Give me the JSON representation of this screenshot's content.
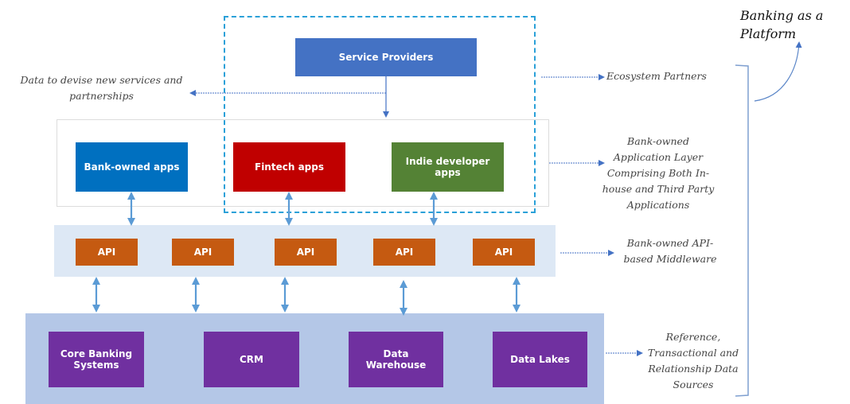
{
  "title": "Banking as a Platform",
  "colors": {
    "service_provider": "#4472c4",
    "bank_owned_app": "#0070c0",
    "fintech_app": "#c00000",
    "indie_app": "#548235",
    "api": "#c55a11",
    "data_source": "#7030a0",
    "middleware_band": "#dde8f5",
    "data_band": "#b4c7e7",
    "connector": "#5b9bd5",
    "ecosystem_border": "#2aa0d8"
  },
  "ecosystem": {
    "service_providers": "Service Providers"
  },
  "application_layer": {
    "apps": [
      {
        "label": "Bank-owned apps"
      },
      {
        "label": "Fintech apps"
      },
      {
        "label": "Indie developer apps"
      }
    ]
  },
  "middleware_layer": {
    "apis": [
      {
        "label": "API"
      },
      {
        "label": "API"
      },
      {
        "label": "API"
      },
      {
        "label": "API"
      },
      {
        "label": "API"
      }
    ]
  },
  "data_layer": {
    "sources": [
      {
        "label": "Core Banking Systems"
      },
      {
        "label": "CRM"
      },
      {
        "label": "Data Warehouse"
      },
      {
        "label": "Data Lakes"
      }
    ]
  },
  "annotations": {
    "data_feedback": "Data to devise new services and partnerships",
    "ecosystem_partners": "Ecosystem Partners",
    "application_layer": "Bank-owned Application Layer Comprising Both In-house and Third Party Applications",
    "middleware": "Bank-owned API-based Middleware",
    "data_sources": "Reference, Transactional and Relationship Data Sources"
  }
}
